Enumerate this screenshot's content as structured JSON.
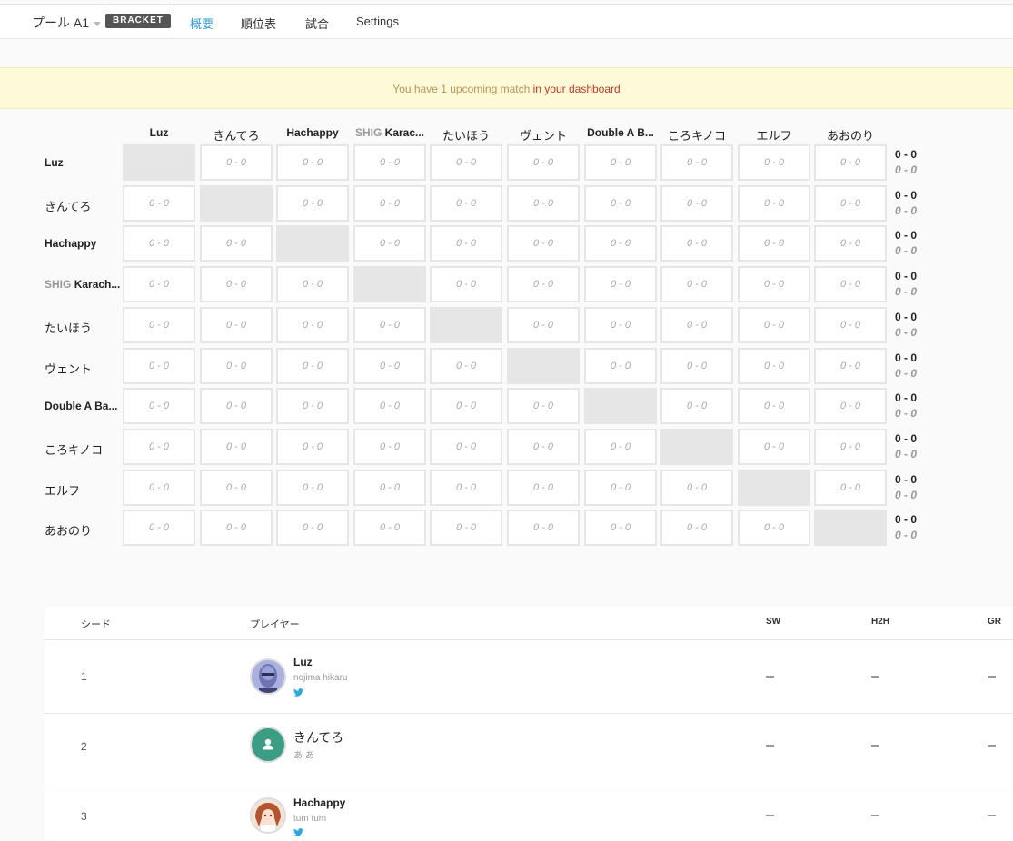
{
  "nav": {
    "pool_label": "プール A1",
    "badge": "BRACKET",
    "tabs": [
      {
        "label": "概要",
        "active": true
      },
      {
        "label": "順位表",
        "active": false
      },
      {
        "label": "試合",
        "active": false
      },
      {
        "label": "Settings",
        "active": false
      }
    ]
  },
  "alert": {
    "text": "You have 1 upcoming match ",
    "link": "in your dashboard"
  },
  "matrix": {
    "columns": [
      {
        "prefix": "",
        "name": "Luz"
      },
      {
        "prefix": "",
        "name": "きんてろ"
      },
      {
        "prefix": "",
        "name": "Hachappy"
      },
      {
        "prefix": "SHIG",
        "name": "Karac..."
      },
      {
        "prefix": "",
        "name": "たいほう"
      },
      {
        "prefix": "",
        "name": "ヴェント"
      },
      {
        "prefix": "",
        "name": "Double A B..."
      },
      {
        "prefix": "",
        "name": "ころキノコ"
      },
      {
        "prefix": "",
        "name": "エルフ"
      },
      {
        "prefix": "",
        "name": "あおのり"
      }
    ],
    "rows": [
      {
        "prefix": "",
        "name": "Luz",
        "record": "0 - 0",
        "games": "0 - 0"
      },
      {
        "prefix": "",
        "name": "きんてろ",
        "record": "0 - 0",
        "games": "0 - 0"
      },
      {
        "prefix": "",
        "name": "Hachappy",
        "record": "0 - 0",
        "games": "0 - 0"
      },
      {
        "prefix": "SHIG",
        "name": "Karach...",
        "record": "0 - 0",
        "games": "0 - 0"
      },
      {
        "prefix": "",
        "name": "たいほう",
        "record": "0 - 0",
        "games": "0 - 0"
      },
      {
        "prefix": "",
        "name": "ヴェント",
        "record": "0 - 0",
        "games": "0 - 0"
      },
      {
        "prefix": "",
        "name": "Double A Ba...",
        "record": "0 - 0",
        "games": "0 - 0"
      },
      {
        "prefix": "",
        "name": "ころキノコ",
        "record": "0 - 0",
        "games": "0 - 0"
      },
      {
        "prefix": "",
        "name": "エルフ",
        "record": "0 - 0",
        "games": "0 - 0"
      },
      {
        "prefix": "",
        "name": "あおのり",
        "record": "0 - 0",
        "games": "0 - 0"
      }
    ],
    "cell_score": "0 - 0"
  },
  "standings": {
    "headers": {
      "seed": "シード",
      "player": "プレイヤー",
      "sw": "SW",
      "h2h": "H2H",
      "gr": "GR"
    },
    "rows": [
      {
        "seed": "1",
        "name": "Luz",
        "desc": "nojima hikaru",
        "twitter": true,
        "avatar": "photo-avatar"
      },
      {
        "seed": "2",
        "name": "きんてろ",
        "desc": "あ あ",
        "twitter": false,
        "avatar": "default-avatar"
      },
      {
        "seed": "3",
        "name": "Hachappy",
        "desc": "tum tum",
        "twitter": true,
        "avatar": "anime-avatar"
      }
    ]
  },
  "colors": {
    "accent": "#2f9bd6",
    "alert_bg": "#fefad8",
    "alert_link": "#c0392b",
    "default_avatar": "#3a9d84"
  }
}
